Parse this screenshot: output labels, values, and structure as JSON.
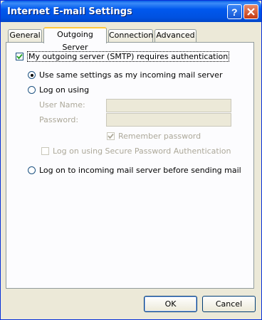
{
  "window": {
    "title": "Internet E-mail Settings"
  },
  "tabs": [
    "General",
    "Outgoing Server",
    "Connection",
    "Advanced"
  ],
  "active_tab": "Outgoing Server",
  "auth_checkbox": {
    "label": "My outgoing server (SMTP) requires authentication",
    "checked": true
  },
  "options": {
    "same_settings": "Use same settings as my incoming mail server",
    "log_on_using": "Log on using",
    "log_on_incoming": "Log on to incoming mail server before sending mail"
  },
  "fields": {
    "user_name_label": "User Name:",
    "password_label": "Password:",
    "user_name_value": "",
    "password_value": ""
  },
  "remember_password": "Remember password",
  "spa": "Log on using Secure Password Authentication",
  "buttons": {
    "ok": "OK",
    "cancel": "Cancel"
  }
}
